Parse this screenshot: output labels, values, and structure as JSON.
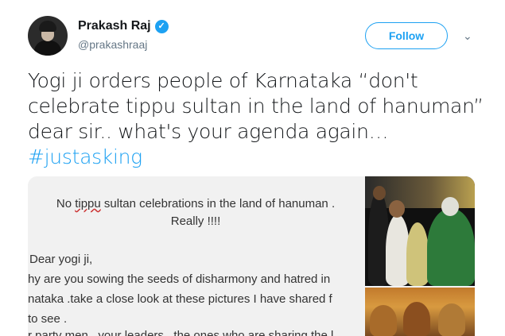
{
  "author": {
    "name": "Prakash Raj",
    "handle": "@prakashraaj",
    "verified_glyph": "✓"
  },
  "actions": {
    "follow_label": "Follow",
    "menu_glyph": "⌄"
  },
  "tweet": {
    "text": "Yogi ji orders people of Karnataka “don't celebrate tippu sultan in the land of hanuman” dear sir.. what's your agenda again…",
    "hashtag": "#justasking"
  },
  "media": {
    "note_title_word": "tippu",
    "note_title_before": "No ",
    "note_title_after": " sultan celebrations in the land of hanuman .",
    "note_title_line2": "Really !!!!",
    "note_lines": [
      "Dear yogi ji,",
      "hy are you sowing the seeds of disharmony and hatred in",
      "nataka .take a close look at these pictures I have shared f",
      " to see .",
      "r party men , your leaders , the ones who are sharing the l"
    ]
  },
  "icons": {
    "verified": "verified-badge-icon",
    "menu": "chevron-down-icon"
  },
  "colors": {
    "accent": "#1da1f2",
    "text": "#14171a",
    "secondary": "#657786"
  }
}
